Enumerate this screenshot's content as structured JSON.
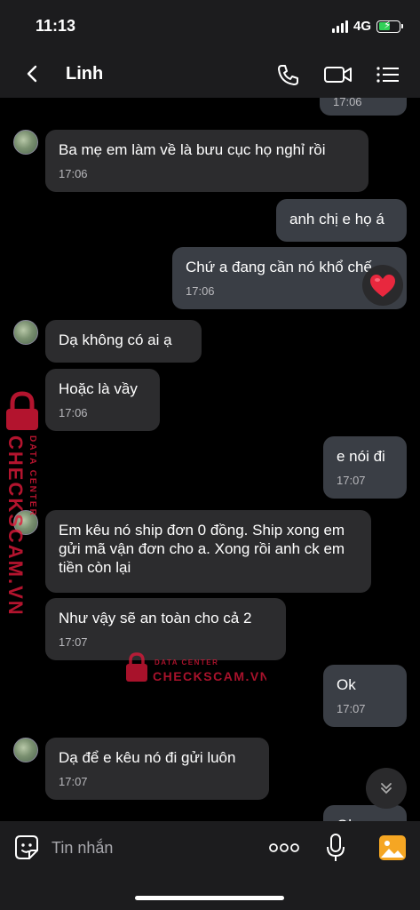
{
  "status_bar": {
    "time": "11:13",
    "network": "4G"
  },
  "header": {
    "title": "Linh",
    "icons": [
      "back-icon",
      "phone-icon",
      "video-icon",
      "menu-icon"
    ]
  },
  "messages": [
    {
      "dir": "out",
      "text": "",
      "time": "17:06"
    },
    {
      "dir": "in",
      "text": "Ba mẹ em làm về là bưu cục họ nghỉ rồi",
      "time": "17:06"
    },
    {
      "dir": "out",
      "text": "anh chị e họ á",
      "time": ""
    },
    {
      "dir": "out",
      "text": "Chứ a đang cần nó khổ chế",
      "time": "17:06",
      "reaction": "heart"
    },
    {
      "dir": "in",
      "text": "Dạ không có ai ạ",
      "time": ""
    },
    {
      "dir": "in",
      "text": "Hoặc là vầy",
      "time": "17:06"
    },
    {
      "dir": "out",
      "text": "e nói đi",
      "time": "17:07"
    },
    {
      "dir": "in",
      "text": "Em kêu nó ship đơn 0 đồng. Ship xong em gửi mã vận đơn cho a. Xong rồi anh ck em tiền còn lại",
      "time": ""
    },
    {
      "dir": "in",
      "text": "Như vậy sẽ an toàn cho cả 2",
      "time": "17:07"
    },
    {
      "dir": "out",
      "text": "Ok",
      "time": "17:07"
    },
    {
      "dir": "in",
      "text": "Dạ để e kêu nó đi gửi luôn",
      "time": "17:07"
    },
    {
      "dir": "out",
      "text": "Ok",
      "time": ""
    }
  ],
  "watermark": {
    "line1": "DATA CENTER",
    "line2": "CHECKSCAM.VN"
  },
  "input": {
    "placeholder": "Tin nhắn"
  },
  "colors": {
    "bubble_in": "#2c2c2e",
    "bubble_out": "#3a3e45",
    "watermark": "#e0193a"
  }
}
